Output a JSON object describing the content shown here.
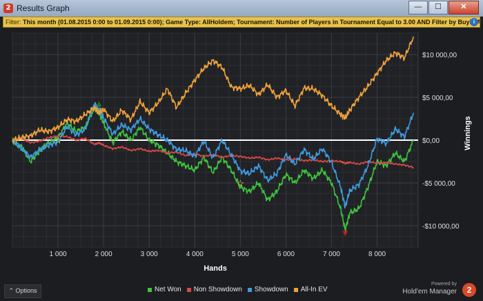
{
  "window": {
    "title": "Results Graph",
    "app_icon": "holdem-manager-2-icon",
    "controls": {
      "minimize": "—",
      "maximize": "☐",
      "close": "✕"
    }
  },
  "filter": {
    "label": "Filter: ",
    "text": "This month (01.08.2015 0:00 to 01.09.2015 0:00); Game Type: AllHoldem; Tournament: Number of Players in Tournament Equal to 3.00 AND Filter by Buyin Amount E",
    "icon": "info-icon"
  },
  "chart_data": {
    "type": "line",
    "xlabel": "Hands",
    "ylabel": "Winnings",
    "xlim": [
      0,
      8900
    ],
    "ylim": [
      -12500,
      12500
    ],
    "x_ticks": [
      {
        "value": 1000,
        "label": "1 000"
      },
      {
        "value": 2000,
        "label": "2 000"
      },
      {
        "value": 3000,
        "label": "3 000"
      },
      {
        "value": 4000,
        "label": "4 000"
      },
      {
        "value": 5000,
        "label": "5 000"
      },
      {
        "value": 6000,
        "label": "6 000"
      },
      {
        "value": 7000,
        "label": "7 000"
      },
      {
        "value": 8000,
        "label": "8 000"
      }
    ],
    "y_ticks": [
      {
        "value": 10000,
        "label": "$10 000,00"
      },
      {
        "value": 5000,
        "label": "$5 000,00"
      },
      {
        "value": 0,
        "label": "$0,00"
      },
      {
        "value": -5000,
        "label": "-$5 000,00"
      },
      {
        "value": -10000,
        "label": "-$10 000,00"
      }
    ],
    "grid": true,
    "legend_position": "bottom",
    "x": [
      0,
      200,
      400,
      600,
      800,
      1000,
      1200,
      1400,
      1600,
      1800,
      1900,
      2000,
      2200,
      2400,
      2600,
      2800,
      3000,
      3200,
      3400,
      3600,
      3800,
      4000,
      4200,
      4400,
      4600,
      4800,
      5000,
      5200,
      5400,
      5600,
      5800,
      6000,
      6200,
      6400,
      6600,
      6800,
      7000,
      7200,
      7300,
      7400,
      7600,
      7800,
      8000,
      8200,
      8400,
      8600,
      8800
    ],
    "series": [
      {
        "name": "Net Won",
        "color": "#3ec43e",
        "values": [
          0,
          -800,
          -2500,
          -1200,
          -300,
          300,
          2000,
          1000,
          1500,
          3800,
          3200,
          2000,
          -300,
          1000,
          0,
          1500,
          0,
          -600,
          -1500,
          -2500,
          -3000,
          -3500,
          -2000,
          -3800,
          -2000,
          -3500,
          -5500,
          -6000,
          -5000,
          -7000,
          -6000,
          -4000,
          -5000,
          -3500,
          -4500,
          -3500,
          -5000,
          -8000,
          -10500,
          -8500,
          -8000,
          -5500,
          -2500,
          -3000,
          -1500,
          -2500,
          0
        ]
      },
      {
        "name": "Non Showdown",
        "color": "#d94a44",
        "values": [
          0,
          200,
          -300,
          -100,
          300,
          500,
          400,
          0,
          200,
          -500,
          -300,
          -600,
          -1000,
          -800,
          -1200,
          -1000,
          -1300,
          -1200,
          -1500,
          -1400,
          -1800,
          -1600,
          -1900,
          -1700,
          -2000,
          -1800,
          -1900,
          -2100,
          -2000,
          -2300,
          -2100,
          -2300,
          -2200,
          -2400,
          -2300,
          -2500,
          -2400,
          -2500,
          -2700,
          -2600,
          -2800,
          -2500,
          -2700,
          -2600,
          -2800,
          -2900,
          -3200
        ]
      },
      {
        "name": "Showdown",
        "color": "#3e9be0",
        "values": [
          0,
          -1000,
          -2000,
          -1100,
          -600,
          -200,
          1600,
          600,
          1300,
          4300,
          3500,
          2600,
          700,
          1800,
          1200,
          2500,
          1300,
          600,
          0,
          -1100,
          -1200,
          -1900,
          -100,
          -2100,
          0,
          -1700,
          -3600,
          -3900,
          -3000,
          -4700,
          -3900,
          -1700,
          -2800,
          -1100,
          -2200,
          -1000,
          -2600,
          -5500,
          -7800,
          -5900,
          -5200,
          -3000,
          200,
          -400,
          1300,
          400,
          3200
        ]
      },
      {
        "name": "All-In EV",
        "color": "#f0a23a",
        "values": [
          0,
          300,
          500,
          1200,
          1000,
          1500,
          2400,
          2200,
          3000,
          3800,
          3200,
          3600,
          2200,
          3500,
          2400,
          4500,
          3200,
          4400,
          6000,
          3800,
          5500,
          7000,
          8400,
          9300,
          8500,
          6200,
          6000,
          6400,
          5300,
          6500,
          5000,
          5800,
          4000,
          6100,
          6000,
          5200,
          4000,
          3000,
          2600,
          3500,
          5000,
          6300,
          7800,
          9300,
          10200,
          9600,
          12100
        ]
      }
    ],
    "markers": [
      {
        "label": "☆",
        "x": 1000,
        "y": 0,
        "color": "#ffe44a",
        "name": "star-marker-1"
      },
      {
        "label": "☆",
        "x": 5000,
        "y": -5000,
        "color": "#ffe44a",
        "name": "star-marker-2"
      },
      {
        "label": "▲",
        "x": 1900,
        "y": 4300,
        "color": "#1f7a2a",
        "name": "peak-marker"
      },
      {
        "label": "▼",
        "x": 7300,
        "y": -10800,
        "color": "#cc1a1a",
        "name": "low-marker"
      }
    ]
  },
  "footer": {
    "options_label": "Options",
    "legend": [
      {
        "label": "Net Won",
        "color": "#3ec43e"
      },
      {
        "label": "Non Showdown",
        "color": "#d94a44"
      },
      {
        "label": "Showdown",
        "color": "#3e9be0"
      },
      {
        "label": "All-In EV",
        "color": "#f0a23a"
      }
    ],
    "powered_by": "Powered by",
    "brand": "Hold'em Manager",
    "brand_badge": "2"
  }
}
